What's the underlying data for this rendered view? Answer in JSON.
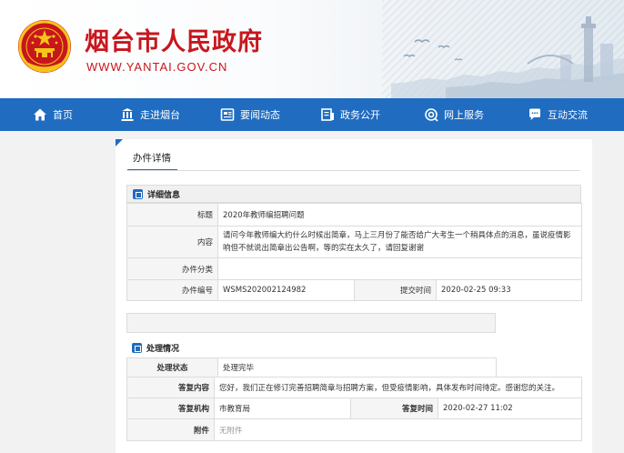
{
  "header": {
    "title": "烟台市人民政府",
    "url": "WWW.YANTAI.GOV.CN",
    "emblem_icon": "national-emblem-icon",
    "brand_color": "#c8161d"
  },
  "nav": {
    "color": "#1f6cc0",
    "items": [
      {
        "label": "首页",
        "icon": "home-icon"
      },
      {
        "label": "走进烟台",
        "icon": "building-icon"
      },
      {
        "label": "要闻动态",
        "icon": "news-icon"
      },
      {
        "label": "政务公开",
        "icon": "document-icon"
      },
      {
        "label": "网上服务",
        "icon": "globe-icon"
      },
      {
        "label": "互动交流",
        "icon": "chat-icon"
      }
    ]
  },
  "page": {
    "tab_title": "办件详情"
  },
  "details": {
    "section_title": "详细信息",
    "title_label": "标题",
    "title_value": "2020年教师编招聘问题",
    "content_label": "内容",
    "content_value": "请问今年教师编大约什么时候出简章，马上三月份了能否给广大考生一个稍具体点的消息，虽说疫情影响但不就说出简章出公告啊，等的实在太久了，请回复谢谢",
    "category_label": "办件分类",
    "category_value": "",
    "number_label": "办件编号",
    "number_value": "WSMS202002124982",
    "submit_time_label": "提交时间",
    "submit_time_value": "2020-02-25 09:33"
  },
  "processing": {
    "section_title": "处理情况",
    "status_label": "处理状态",
    "status_value": "处理完毕",
    "reply_label": "答复内容",
    "reply_value": "您好，我们正在修订完善招聘简章与招聘方案，但受疫情影响，具体发布时间待定。感谢您的关注。",
    "org_label": "答复机构",
    "org_value": "市教育局",
    "reply_time_label": "答复时间",
    "reply_time_value": "2020-02-27 11:02",
    "attachment_label": "附件",
    "attachment_value": "无附件"
  }
}
